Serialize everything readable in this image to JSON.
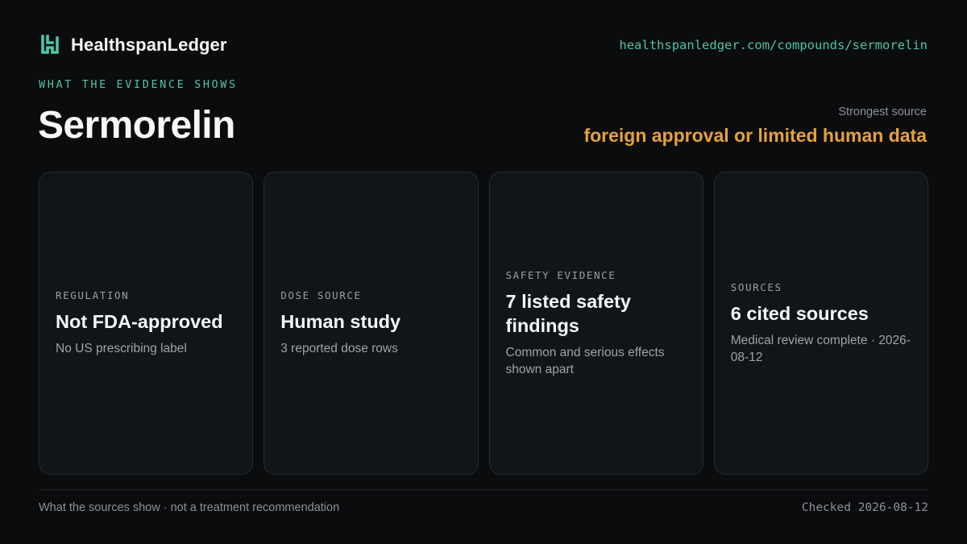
{
  "header": {
    "brand_name": "HealthspanLedger",
    "logo_icon": "brand-logo-icon",
    "url": "healthspanledger.com/compounds/sermorelin"
  },
  "hero": {
    "eyebrow": "WHAT THE EVIDENCE SHOWS",
    "title": "Sermorelin",
    "strongest_source_label": "Strongest source",
    "strongest_source_value": "foreign approval or limited human data"
  },
  "cards": [
    {
      "label": "REGULATION",
      "value": "Not FDA-approved",
      "note": "No US prescribing label"
    },
    {
      "label": "DOSE SOURCE",
      "value": "Human study",
      "note": "3 reported dose rows"
    },
    {
      "label": "SAFETY EVIDENCE",
      "value": "7 listed safety findings",
      "note": "Common and serious effects shown apart"
    },
    {
      "label": "SOURCES",
      "value": "6 cited sources",
      "note": "Medical review complete · 2026-08-12"
    }
  ],
  "footer": {
    "disclaimer": "What the sources show · not a treatment recommendation",
    "checked": "Checked 2026-08-12"
  },
  "colors": {
    "background": "#0b0c0e",
    "accent_teal": "#4fc3a8",
    "accent_amber": "#e5a13e",
    "card_background": "#121518",
    "card_border": "#262a2f"
  }
}
